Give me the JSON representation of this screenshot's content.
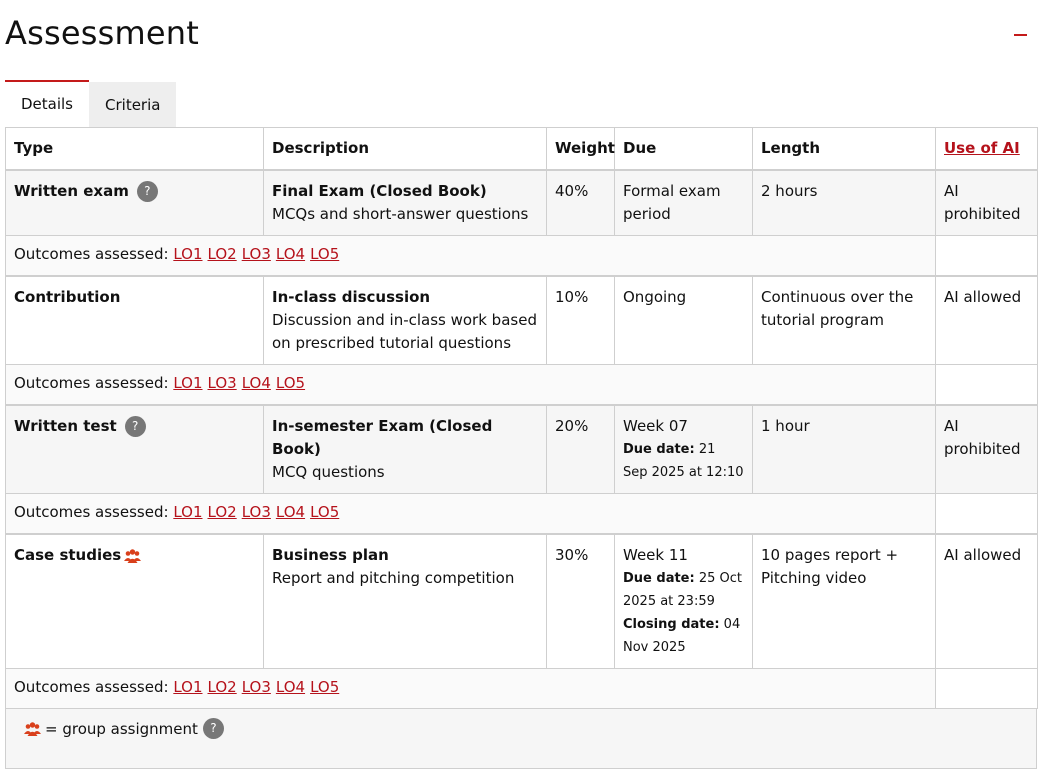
{
  "header": {
    "title": "Assessment"
  },
  "tabs": [
    {
      "label": "Details"
    },
    {
      "label": "Criteria"
    }
  ],
  "table": {
    "columns": {
      "type": "Type",
      "description": "Description",
      "weight": "Weight",
      "due": "Due",
      "length": "Length",
      "ai": "Use of AI"
    },
    "outcomes_label": "Outcomes assessed:",
    "rows": [
      {
        "type": "Written exam",
        "desc_title": "Final Exam (Closed Book)",
        "desc_text": "MCQs and short-answer questions",
        "weight": "40%",
        "due": "Formal exam period",
        "length": "2 hours",
        "ai": "AI prohibited",
        "outcomes": [
          "LO1",
          "LO2",
          "LO3",
          "LO4",
          "LO5"
        ]
      },
      {
        "type": "Contribution",
        "desc_title": "In-class discussion",
        "desc_text": "Discussion and in-class work based on prescribed tutorial questions",
        "weight": "10%",
        "due": "Ongoing",
        "length": "Continuous over the tutorial program",
        "ai": "AI allowed",
        "outcomes": [
          "LO1",
          "LO3",
          "LO4",
          "LO5"
        ]
      },
      {
        "type": "Written test",
        "desc_title": "In-semester Exam (Closed Book)",
        "desc_text": "MCQ questions",
        "weight": "20%",
        "due": "Week 07",
        "due_date_label": "Due date:",
        "due_date": "21 Sep 2025 at 12:10",
        "length": "1 hour",
        "ai": "AI prohibited",
        "outcomes": [
          "LO1",
          "LO2",
          "LO3",
          "LO4",
          "LO5"
        ]
      },
      {
        "type": "Case studies",
        "desc_title": "Business plan",
        "desc_text": "Report and pitching competition",
        "weight": "30%",
        "due": "Week 11",
        "due_date_label": "Due date:",
        "due_date": "25 Oct 2025 at 23:59",
        "closing_date_label": "Closing date:",
        "closing_date": "04 Nov 2025",
        "length": "10 pages report + Pitching video",
        "ai": "AI allowed",
        "outcomes": [
          "LO1",
          "LO2",
          "LO3",
          "LO4",
          "LO5"
        ]
      }
    ]
  },
  "footer": {
    "legend": "= group assignment"
  },
  "icons": {
    "help": "?",
    "group": "group-icon"
  },
  "colors": {
    "accent": "#c41a1a",
    "link": "#b5121b",
    "help_bg": "#777777",
    "group_icon": "#d9401c"
  }
}
